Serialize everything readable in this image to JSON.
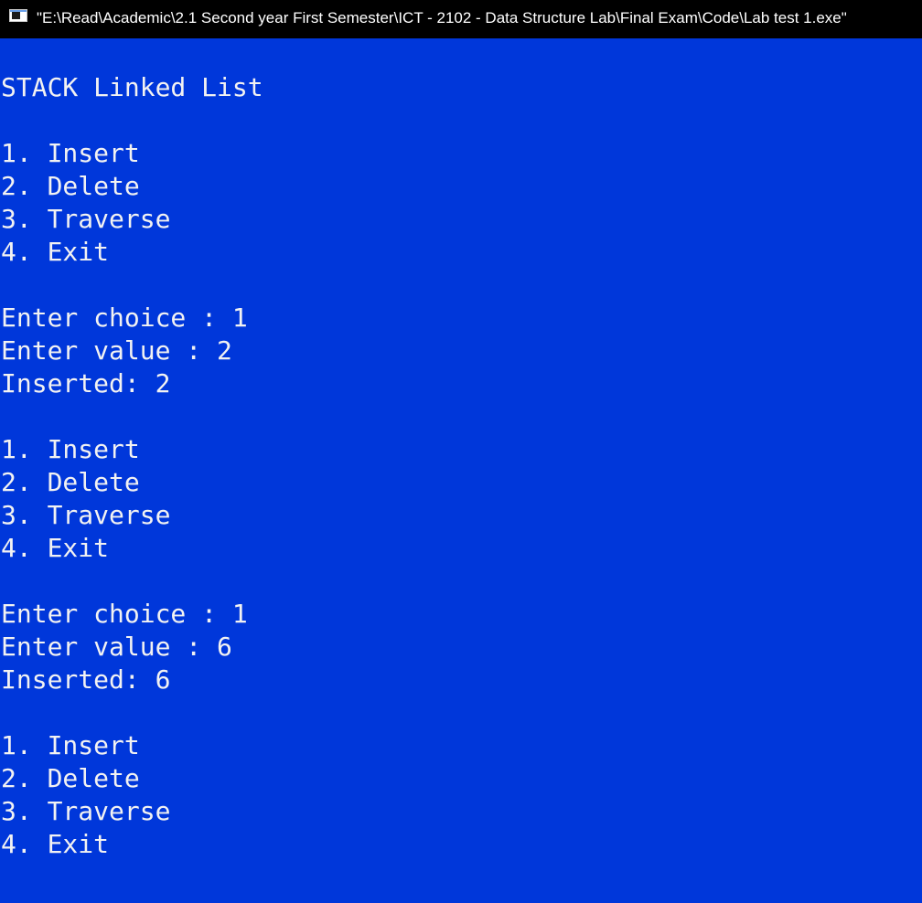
{
  "window": {
    "title": "\"E:\\Read\\Academic\\2.1 Second year First Semester\\ICT - 2102 - Data Structure Lab\\Final Exam\\Code\\Lab test 1.exe\"",
    "icon": "console-app-icon",
    "colors": {
      "titlebar_bg": "#000000",
      "console_bg": "#0037da",
      "console_text": "#f2f2f2"
    }
  },
  "console": {
    "lines": [
      "STACK Linked List",
      "",
      "1. Insert",
      "2. Delete",
      "3. Traverse",
      "4. Exit",
      "",
      "Enter choice : 1",
      "Enter value : 2",
      "Inserted: 2",
      "",
      "1. Insert",
      "2. Delete",
      "3. Traverse",
      "4. Exit",
      "",
      "Enter choice : 1",
      "Enter value : 6",
      "Inserted: 6",
      "",
      "1. Insert",
      "2. Delete",
      "3. Traverse",
      "4. Exit"
    ]
  }
}
